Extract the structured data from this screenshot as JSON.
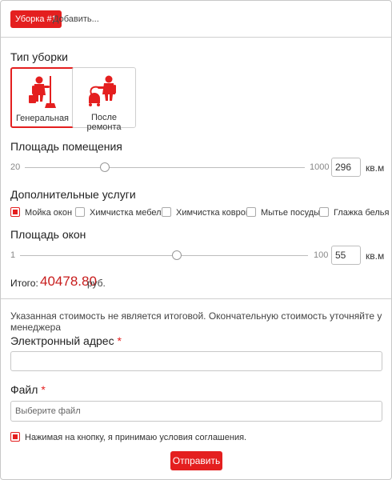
{
  "tabs": {
    "active_label": "Уборка #1",
    "add_label": "Добавить..."
  },
  "cleaning_type": {
    "label": "Тип уборки",
    "options": [
      {
        "label": "Генеральная",
        "icon": "cleaner-mop-icon",
        "selected": true
      },
      {
        "label": "После ремонта",
        "icon": "vacuum-cleaner-icon",
        "selected": false
      }
    ]
  },
  "area": {
    "label": "Площадь помещения",
    "min": "20",
    "max": "1000",
    "value": "296",
    "unit": "кв.м"
  },
  "extras": {
    "label": "Дополнительные услуги",
    "items": [
      {
        "label": "Мойка окон",
        "checked": true
      },
      {
        "label": "Химчистка мебели",
        "checked": false
      },
      {
        "label": "Химчистка ковров",
        "checked": false
      },
      {
        "label": "Мытье посуды",
        "checked": false
      },
      {
        "label": "Глажка белья",
        "checked": false
      }
    ]
  },
  "windows": {
    "label": "Площадь окон",
    "min": "1",
    "max": "100",
    "value": "55",
    "unit": "кв.м"
  },
  "total": {
    "label": "Итого:",
    "value": "40478.80",
    "currency": "руб."
  },
  "note": "Указанная стоимость не является итоговой. Окончательную стоимость уточняйте у менеджера",
  "email": {
    "label": "Электронный адрес",
    "required_mark": "*",
    "value": ""
  },
  "file": {
    "label": "Файл",
    "required_mark": "*",
    "placeholder": "Выберите файл"
  },
  "agreement": {
    "label": "Нажимая на кнопку, я принимаю условия соглашения.",
    "checked": true
  },
  "submit_label": "Отправить",
  "colors": {
    "accent": "#e41f1f"
  }
}
